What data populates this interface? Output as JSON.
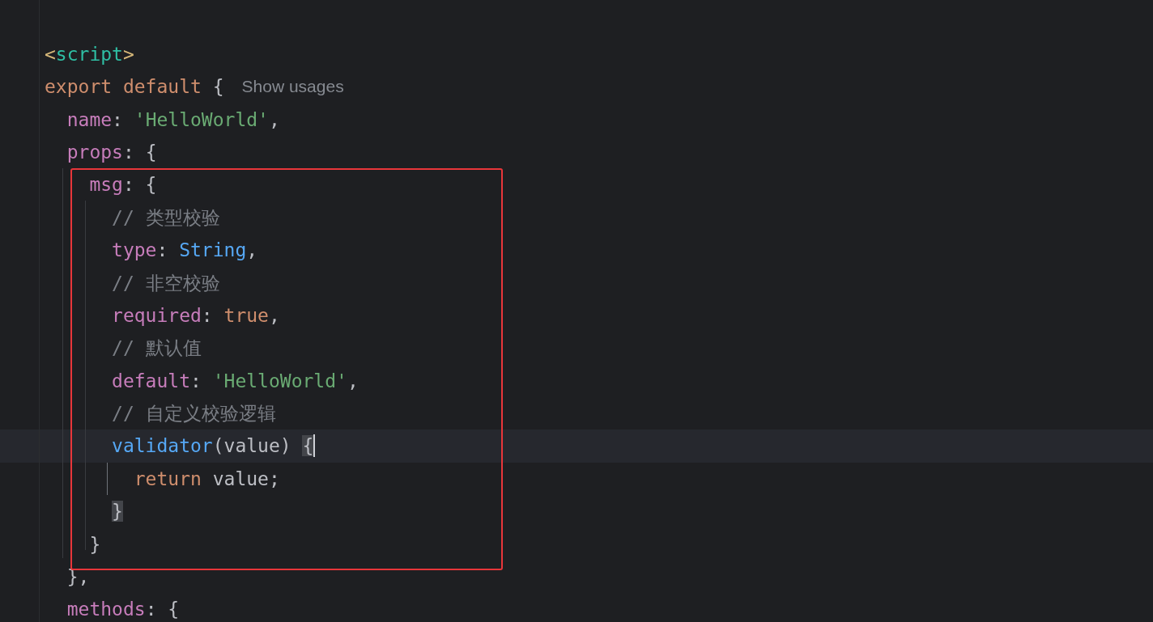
{
  "editor": {
    "lines": [
      {
        "tokens": [
          {
            "kind": "tag-bracket",
            "text": "<"
          },
          {
            "kind": "tag",
            "text": "script"
          },
          {
            "kind": "tag-bracket",
            "text": ">"
          }
        ]
      },
      {
        "tokens": [
          {
            "kind": "keyword",
            "text": "export default "
          },
          {
            "kind": "plain",
            "text": "{"
          }
        ],
        "hint": "Show usages",
        "children": [
          {
            "tokens": [
              {
                "kind": "property",
                "text": "name"
              },
              {
                "kind": "plain",
                "text": ": "
              },
              {
                "kind": "string",
                "text": "'HelloWorld'"
              },
              {
                "kind": "plain",
                "text": ","
              }
            ]
          },
          {
            "tokens": [
              {
                "kind": "property",
                "text": "props"
              },
              {
                "kind": "plain",
                "text": ": {"
              }
            ],
            "children": [
              {
                "tokens": [
                  {
                    "kind": "property",
                    "text": "msg"
                  },
                  {
                    "kind": "plain",
                    "text": ": {"
                  }
                ],
                "children": [
                  {
                    "tokens": [
                      {
                        "kind": "comment",
                        "text": "// 类型校验"
                      }
                    ]
                  },
                  {
                    "tokens": [
                      {
                        "kind": "property",
                        "text": "type"
                      },
                      {
                        "kind": "plain",
                        "text": ": "
                      },
                      {
                        "kind": "type",
                        "text": "String"
                      },
                      {
                        "kind": "plain",
                        "text": ","
                      }
                    ]
                  },
                  {
                    "tokens": [
                      {
                        "kind": "comment",
                        "text": "// 非空校验"
                      }
                    ]
                  },
                  {
                    "tokens": [
                      {
                        "kind": "property",
                        "text": "required"
                      },
                      {
                        "kind": "plain",
                        "text": ": "
                      },
                      {
                        "kind": "keyword",
                        "text": "true"
                      },
                      {
                        "kind": "plain",
                        "text": ","
                      }
                    ]
                  },
                  {
                    "tokens": [
                      {
                        "kind": "comment",
                        "text": "// 默认值"
                      }
                    ]
                  },
                  {
                    "tokens": [
                      {
                        "kind": "property",
                        "text": "default"
                      },
                      {
                        "kind": "plain",
                        "text": ": "
                      },
                      {
                        "kind": "string",
                        "text": "'HelloWorld'"
                      },
                      {
                        "kind": "plain",
                        "text": ","
                      }
                    ]
                  },
                  {
                    "tokens": [
                      {
                        "kind": "comment",
                        "text": "// 自定义校验逻辑"
                      }
                    ]
                  },
                  {
                    "tokens": [
                      {
                        "kind": "function",
                        "text": "validator"
                      },
                      {
                        "kind": "plain",
                        "text": "(value) "
                      },
                      {
                        "kind": "plain",
                        "text": "{",
                        "matched": true
                      }
                    ],
                    "current": true,
                    "cursor": true,
                    "children": [
                      {
                        "tokens": [
                          {
                            "kind": "keyword",
                            "text": "return"
                          },
                          {
                            "kind": "plain",
                            "text": " value;"
                          }
                        ]
                      }
                    ]
                  },
                  {
                    "tokens": [
                      {
                        "kind": "plain",
                        "text": "}",
                        "matched": true
                      }
                    ]
                  }
                ]
              },
              {
                "tokens": [
                  {
                    "kind": "plain",
                    "text": "}"
                  }
                ]
              }
            ]
          },
          {
            "tokens": [
              {
                "kind": "plain",
                "text": "},"
              }
            ]
          },
          {
            "tokens": [
              {
                "kind": "property",
                "text": "methods"
              },
              {
                "kind": "plain",
                "text": ": {"
              }
            ]
          }
        ]
      }
    ]
  }
}
